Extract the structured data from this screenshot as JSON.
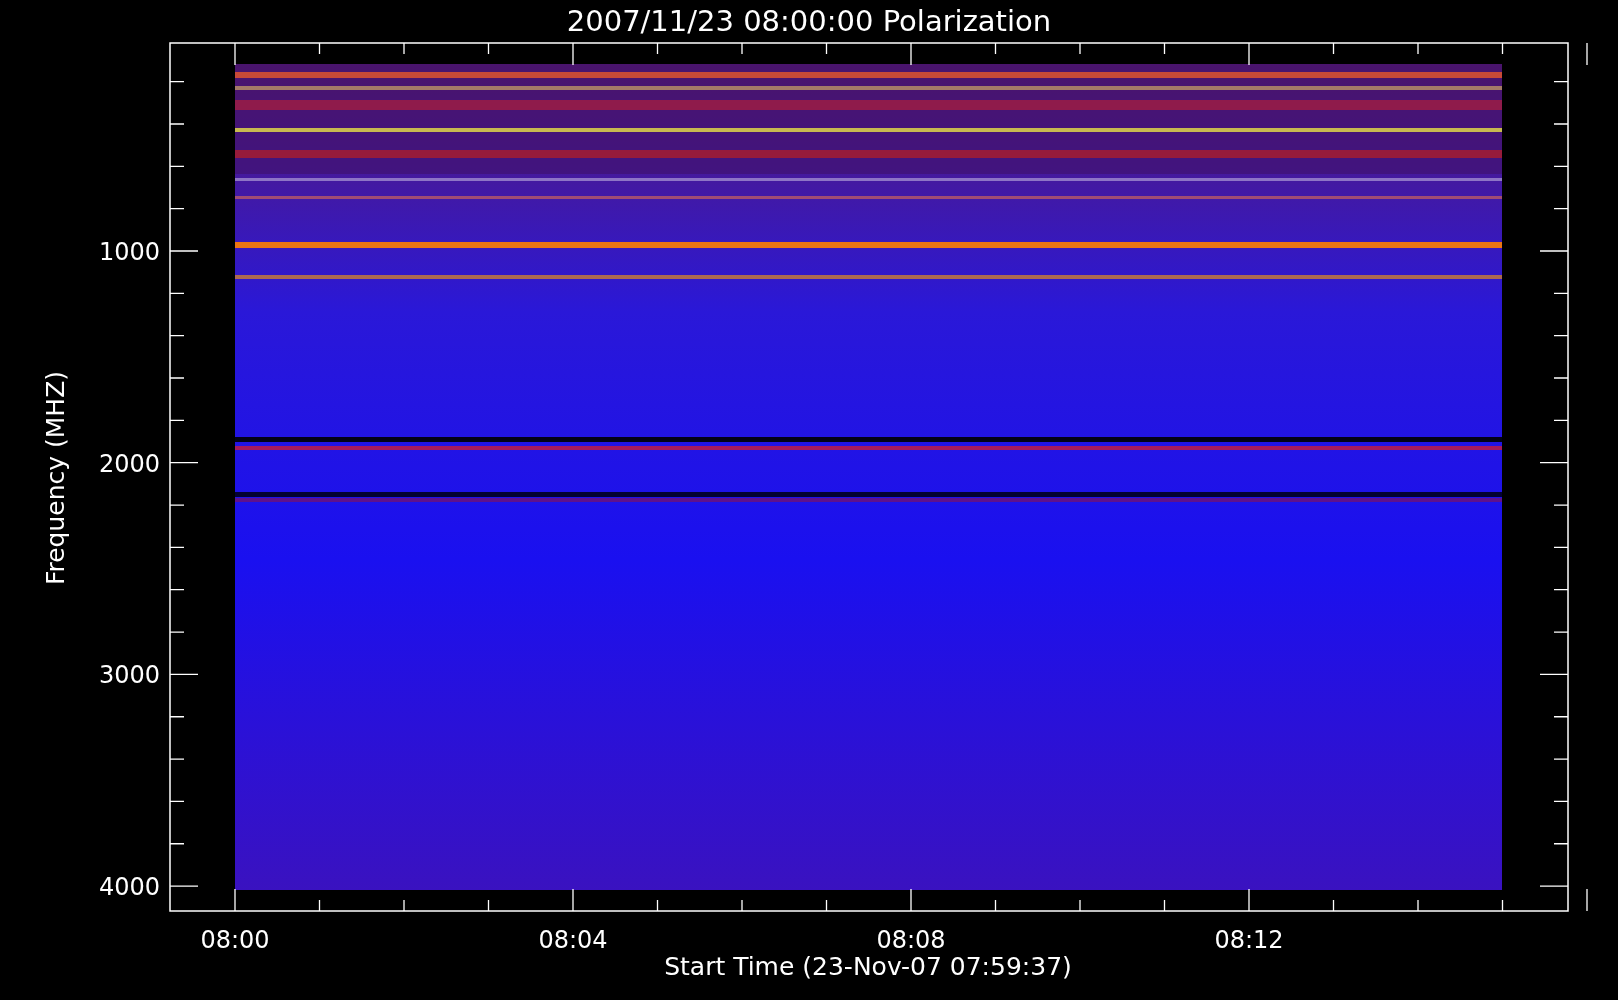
{
  "title": "2007/11/23 08:00:00 Polarization",
  "x_axis": {
    "label": "Start Time (23-Nov-07 07:59:37)",
    "ticks": [
      "08:00",
      "08:04",
      "08:08",
      "08:12"
    ]
  },
  "y_axis": {
    "label": "Frequency (MHZ)",
    "ticks": [
      "1000",
      "2000",
      "3000",
      "4000"
    ]
  }
}
